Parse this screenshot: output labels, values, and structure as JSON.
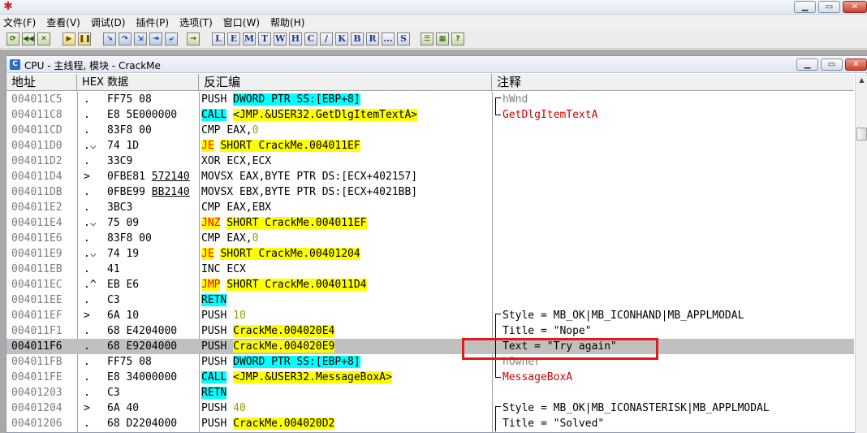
{
  "app": {
    "icon": "ollydbg-bug-icon"
  },
  "menu": [
    "文件(F)",
    "查看(V)",
    "调试(D)",
    "插件(P)",
    "选项(T)",
    "窗口(W)",
    "帮助(H)"
  ],
  "toolbar": {
    "group1": [
      "restart-icon",
      "rewind-icon",
      "close-process-icon"
    ],
    "group2": [
      "run-icon",
      "pause-icon"
    ],
    "group3": [
      "step-into-icon",
      "step-over-icon",
      "trace-into-icon",
      "trace-over-icon",
      "execute-till-return-icon"
    ],
    "group4": [
      "goto-icon"
    ],
    "letters": [
      "L",
      "E",
      "M",
      "T",
      "W",
      "H",
      "C",
      "/",
      "K",
      "B",
      "R",
      "...",
      "S"
    ],
    "group5": [
      "list-icon",
      "grid-icon",
      "help-icon"
    ]
  },
  "cpu_window": {
    "title": "CPU - 主线程, 模块 - CrackMe",
    "icon_letter": "C",
    "columns": {
      "address": "地址",
      "hex": "HEX 数据",
      "disasm": "反汇编",
      "comment": "注释"
    }
  },
  "rows": [
    {
      "addr": "004011C5",
      "mark": ".",
      "hex": "FF75 08",
      "op": "PUSH",
      "op_hl": "",
      "args": "DWORD PTR SS:[EBP+8]",
      "args_hl": "cyan",
      "cmt": "hWnd",
      "cmt_color": "gray",
      "brk": "top"
    },
    {
      "addr": "004011C8",
      "mark": ".",
      "hex": "E8 5E000000",
      "op": "CALL",
      "op_hl": "cyan",
      "args": "<JMP.&USER32.GetDlgItemTextA>",
      "args_hl": "yellow",
      "cmt": "GetDlgItemTextA",
      "cmt_color": "red",
      "brk": "bottom"
    },
    {
      "addr": "004011CD",
      "mark": ".",
      "hex": "83F8 00",
      "op": "CMP",
      "op_hl": "",
      "args": "EAX,0",
      "args_hl": "",
      "cmt": "",
      "cmt_color": "",
      "brk": ""
    },
    {
      "addr": "004011D0",
      "mark": ".⌵",
      "hex": "74 1D",
      "op": "JE",
      "op_hl": "yellow-red",
      "args": "SHORT CrackMe.004011EF",
      "args_hl": "yellow",
      "cmt": "",
      "cmt_color": "",
      "brk": ""
    },
    {
      "addr": "004011D2",
      "mark": ".",
      "hex": "33C9",
      "op": "XOR",
      "op_hl": "",
      "args": "ECX,ECX",
      "args_hl": "",
      "cmt": "",
      "cmt_color": "",
      "brk": ""
    },
    {
      "addr": "004011D4",
      "mark": ">",
      "hex": "0FBE81 572140",
      "op": "MOVSX",
      "op_hl": "",
      "args": "EAX,BYTE PTR DS:[ECX+402157]",
      "args_hl": "",
      "cmt": "",
      "cmt_color": "",
      "brk": ""
    },
    {
      "addr": "004011DB",
      "mark": ".",
      "hex": "0FBE99 BB2140",
      "op": "MOVSX",
      "op_hl": "",
      "args": "EBX,BYTE PTR DS:[ECX+4021BB]",
      "args_hl": "",
      "cmt": "",
      "cmt_color": "",
      "brk": ""
    },
    {
      "addr": "004011E2",
      "mark": ".",
      "hex": "3BC3",
      "op": "CMP",
      "op_hl": "",
      "args": "EAX,EBX",
      "args_hl": "",
      "cmt": "",
      "cmt_color": "",
      "brk": ""
    },
    {
      "addr": "004011E4",
      "mark": ".⌵",
      "hex": "75 09",
      "op": "JNZ",
      "op_hl": "yellow-red",
      "args": "SHORT CrackMe.004011EF",
      "args_hl": "yellow",
      "cmt": "",
      "cmt_color": "",
      "brk": ""
    },
    {
      "addr": "004011E6",
      "mark": ".",
      "hex": "83F8 00",
      "op": "CMP",
      "op_hl": "",
      "args": "EAX,0",
      "args_hl": "",
      "cmt": "",
      "cmt_color": "",
      "brk": ""
    },
    {
      "addr": "004011E9",
      "mark": ".⌵",
      "hex": "74 19",
      "op": "JE",
      "op_hl": "yellow-red",
      "args": "SHORT CrackMe.00401204",
      "args_hl": "yellow",
      "cmt": "",
      "cmt_color": "",
      "brk": ""
    },
    {
      "addr": "004011EB",
      "mark": ".",
      "hex": "41",
      "op": "INC",
      "op_hl": "",
      "args": "ECX",
      "args_hl": "",
      "cmt": "",
      "cmt_color": "",
      "brk": ""
    },
    {
      "addr": "004011EC",
      "mark": ".^",
      "hex": "EB E6",
      "op": "JMP",
      "op_hl": "yellow-red",
      "args": "SHORT CrackMe.004011D4",
      "args_hl": "yellow",
      "cmt": "",
      "cmt_color": "",
      "brk": ""
    },
    {
      "addr": "004011EE",
      "mark": ".",
      "hex": "C3",
      "op": "RETN",
      "op_hl": "cyan",
      "args": "",
      "args_hl": "",
      "cmt": "",
      "cmt_color": "",
      "brk": ""
    },
    {
      "addr": "004011EF",
      "mark": ">",
      "hex": "6A 10",
      "op": "PUSH",
      "op_hl": "",
      "args": "10",
      "args_hl": "num",
      "cmt": "Style = MB_OK|MB_ICONHAND|MB_APPLMODAL",
      "cmt_color": "black",
      "brk": "top"
    },
    {
      "addr": "004011F1",
      "mark": ".",
      "hex": "68 E4204000",
      "op": "PUSH",
      "op_hl": "",
      "args": "CrackMe.004020E4",
      "args_hl": "yellow",
      "cmt": "Title = \"Nope\"",
      "cmt_color": "black",
      "brk": "mid"
    },
    {
      "addr": "004011F6",
      "mark": ".",
      "hex": "68 E9204000",
      "op": "PUSH",
      "op_hl": "",
      "args": "CrackMe.004020E9",
      "args_hl": "yellow",
      "cmt": "Text = \"Try again\"",
      "cmt_color": "black",
      "brk": "mid",
      "selected": true
    },
    {
      "addr": "004011FB",
      "mark": ".",
      "hex": "FF75 08",
      "op": "PUSH",
      "op_hl": "",
      "args": "DWORD PTR SS:[EBP+8]",
      "args_hl": "cyan",
      "cmt": "hOwner",
      "cmt_color": "gray",
      "brk": "mid"
    },
    {
      "addr": "004011FE",
      "mark": ".",
      "hex": "E8 34000000",
      "op": "CALL",
      "op_hl": "cyan",
      "args": "<JMP.&USER32.MessageBoxA>",
      "args_hl": "yellow",
      "cmt": "MessageBoxA",
      "cmt_color": "red",
      "brk": "bottom"
    },
    {
      "addr": "00401203",
      "mark": ".",
      "hex": "C3",
      "op": "RETN",
      "op_hl": "cyan",
      "args": "",
      "args_hl": "",
      "cmt": "",
      "cmt_color": "",
      "brk": ""
    },
    {
      "addr": "00401204",
      "mark": ">",
      "hex": "6A 40",
      "op": "PUSH",
      "op_hl": "",
      "args": "40",
      "args_hl": "num",
      "cmt": "Style = MB_OK|MB_ICONASTERISK|MB_APPLMODAL",
      "cmt_color": "black",
      "brk": "top"
    },
    {
      "addr": "00401206",
      "mark": ".",
      "hex": "68 D2204000",
      "op": "PUSH",
      "op_hl": "",
      "args": "CrackMe.004020D2",
      "args_hl": "yellow",
      "cmt": "Title = \"Solved\"",
      "cmt_color": "black",
      "brk": "mid"
    }
  ],
  "colors": {
    "highlight_yellow": "#ffff00",
    "highlight_cyan": "#00ffff",
    "jump_red": "#ff0000",
    "selection": "#c0c0c0",
    "annotation_box": "#e01b1b"
  }
}
